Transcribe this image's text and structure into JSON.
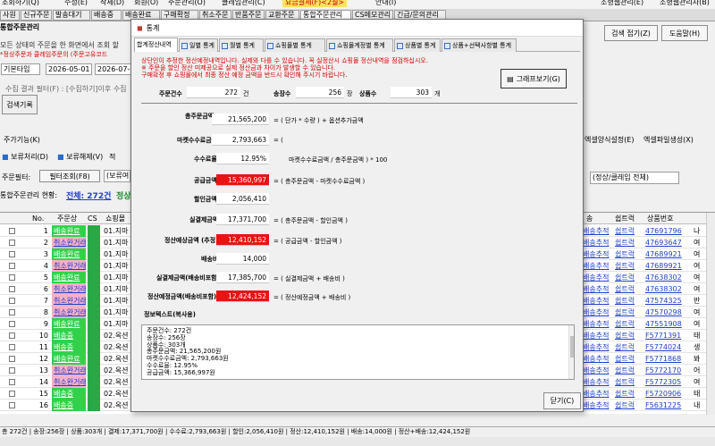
{
  "top_bar": {
    "left_items": [
      "조회하기(Q)",
      "수정(E)",
      "삭제(D)",
      "회원(O)",
      "주문관리(O)",
      "클레임관리(C)",
      "도기(V)",
      "요금결제(F)<2월>",
      "안내(I)"
    ],
    "right_items": [
      "소형웹관리(E)",
      "소형웹관리자(B)"
    ]
  },
  "menu_tabs": [
    "사원",
    "신규주문",
    "발송대기",
    "배송중",
    "배송완료",
    "구매확정",
    "취소주문",
    "반품주문",
    "교환주문",
    "통합주문관리",
    "CS메모관리",
    "긴급/문의관리"
  ],
  "main": {
    "title": "통합주문관리",
    "desc1": "모든 상태의 주문을 한 화면에서 조회 할",
    "desc2": "*정상주문과 클레임주문의 (주문고유코드",
    "period_type": "기본타입",
    "date_from": "2026-05-01",
    "date_to": "2026-07-0",
    "filter_text": "수집 결과 필터(F) : [수집하기]이후 수집",
    "search_label": "검색기록",
    "feature_label": "주가기능(K)",
    "hold_label": "보류처리(D)",
    "unhold_label": "보류해제(V)",
    "apply_label": "적",
    "order_filter_label": "주문필터:",
    "filter_lookup_label": "필터조회(F8)",
    "filter_select": "(보류여",
    "count_label": "통합주문관리 현황:",
    "count_value": "전체: 272건",
    "count_extra": "정상",
    "search_collapse": "검색 접기(Z)",
    "help": "도움말(H)",
    "excel_set": "엑셀양식설정(E)",
    "excel_make": "엑셀파일생성(X)",
    "status_select": "(정상/클레임 전체)"
  },
  "grid": {
    "headers": [
      "No.",
      "주문상",
      "CS",
      "쇼핑몰",
      "송",
      "쉽트럭",
      "상품번호"
    ],
    "rows": [
      {
        "no": "1",
        "status": "배송완료",
        "mall": "01.지마",
        "track": "배송추적",
        "ship": "쉽트럭",
        "prod": "47691796",
        "x": "나"
      },
      {
        "no": "2",
        "status": "취소완거래",
        "mall": "01.지마",
        "track": "배송추적",
        "ship": "쉽트럭",
        "prod": "47693647",
        "x": "여"
      },
      {
        "no": "3",
        "status": "배송완료",
        "mall": "01.지마",
        "track": "배송추적",
        "ship": "쉽트럭",
        "prod": "47689921",
        "x": "여"
      },
      {
        "no": "4",
        "status": "취소완거래",
        "mall": "01.지마",
        "track": "배송추적",
        "ship": "쉽트럭",
        "prod": "47689921",
        "x": "여"
      },
      {
        "no": "5",
        "status": "배송완료",
        "mall": "01.지마",
        "track": "배송추적",
        "ship": "쉽트럭",
        "prod": "47638302",
        "x": "여"
      },
      {
        "no": "6",
        "status": "취소완거래",
        "mall": "01.지마",
        "track": "배송추적",
        "ship": "쉽트럭",
        "prod": "47638302",
        "x": "여"
      },
      {
        "no": "7",
        "status": "취소완거래",
        "mall": "01.지마",
        "track": "배송추적",
        "ship": "쉽트럭",
        "prod": "47574325",
        "x": "반"
      },
      {
        "no": "8",
        "status": "취소완거래",
        "mall": "01.지마",
        "track": "배송추적",
        "ship": "쉽트럭",
        "prod": "47570298",
        "x": "여"
      },
      {
        "no": "9",
        "status": "배송완료",
        "mall": "01.지마",
        "track": "배송추적",
        "ship": "쉽트럭",
        "prod": "47551908",
        "x": "여"
      },
      {
        "no": "10",
        "status": "배송중",
        "mall": "02.옥션",
        "track": "배송추적",
        "ship": "쉽트럭",
        "prod": "F5771391",
        "x": "태"
      },
      {
        "no": "11",
        "status": "배송중",
        "mall": "02.옥션",
        "track": "배송추적",
        "ship": "쉽트럭",
        "prod": "F5774024",
        "x": "생"
      },
      {
        "no": "12",
        "status": "배송완료",
        "mall": "02.옥션",
        "track": "배송추적",
        "ship": "쉽트럭",
        "prod": "F5771868",
        "x": "봐"
      },
      {
        "no": "13",
        "status": "취소완거래",
        "mall": "02.옥션",
        "track": "배송추적",
        "ship": "쉽트럭",
        "prod": "F5772170",
        "x": "어"
      },
      {
        "no": "14",
        "status": "취소완거래",
        "mall": "02.옥션",
        "track": "배송추적",
        "ship": "쉽트럭",
        "prod": "F5772305",
        "x": "여"
      },
      {
        "no": "15",
        "status": "배송중",
        "mall": "02.옥션",
        "track": "배송추적",
        "ship": "쉽트럭",
        "prod": "F5720906",
        "x": "태"
      },
      {
        "no": "16",
        "status": "배송중",
        "mall": "02.옥션",
        "track": "배송추적",
        "ship": "쉽트럭",
        "prod": "F5631225",
        "x": "내"
      }
    ]
  },
  "status_bar": "총 272건 | 송장:256장 | 상품:303개 | 결제:17,371,700원 | 수수료:2,793,663원 | 할인:2,056,410원 | 정산:12,410,152원 | 배송:14,000원 | 정산+배송:12,424,152원",
  "dialog": {
    "title": "통계",
    "tabs": [
      "합계정산내역",
      "일별 통계",
      "월별 통계",
      "쇼핑몰별 통계",
      "쇼핑몰계정별 통계",
      "상품별 통계",
      "상품+선택사항별 통계"
    ],
    "notice": [
      "상단인이 추정한 정산예정내역입니다. 실제와 다를 수 있습니다. 꼭 실정산시 쇼핑몰 정산내역을 점검하십시오.",
      "※ 주문을 할인 정산 미제공으로 실제 정산금과 차이가 발생할 수 있습니다.",
      "구매확정 후 쇼핑몰에서 최종 정산 예정 금액을 반드시 확인해 주시기 바랍니다."
    ],
    "graph_button": "그래프보기(G)",
    "summary": {
      "orders_label": "주문건수",
      "orders_value": "272",
      "orders_unit": "건",
      "invoices_label": "송장수",
      "invoices_value": "256",
      "invoices_unit": "장",
      "items_label": "상품수",
      "items_value": "303",
      "items_unit": "개"
    },
    "rows": [
      {
        "label": "총주문금액",
        "value": "",
        "formula": ""
      },
      {
        "label": "",
        "value": "21,565,200",
        "formula": "= ( 단가  *  수량 )  +  옵션추가금액"
      },
      {
        "label": "마켓수수료금액",
        "value": "2,793,663",
        "formula": "= ("
      },
      {
        "label": "수수료율",
        "value": "12.95%",
        "formula": "마켓수수료금액   /   총주문금액  ) * 100"
      },
      {
        "label": "공급금액",
        "value": "15,360,997",
        "formula": "= ( 총주문금액   -   마켓수수료금액 )"
      },
      {
        "label": "할인금액",
        "value": "2,056,410",
        "formula": ""
      },
      {
        "label": "실결제금액",
        "value": "17,371,700",
        "formula": "= ( 총주문금액   -   할인금액 )"
      },
      {
        "label": "정산예상금액 (추정)",
        "value": "12,410,152",
        "formula": "= ( 공급금액   -   할인금액 )"
      },
      {
        "label": "배송비",
        "value": "14,000",
        "formula": ""
      },
      {
        "label": "실결제금액(배송비포함)",
        "value": "17,385,700",
        "formula": "= ( 실결제금액   +   배송비 )"
      },
      {
        "label": "정산예정금액(배송비포함)",
        "value": "12,424,152",
        "formula": "= ( 정산예정금액   +   배송비 )"
      }
    ],
    "info_title": "정보텍스트(복사용)",
    "info_lines": [
      "주문건수: 272건",
      "송장수: 256장",
      "상품수: 303개",
      "총주문금액: 21,565,200원",
      "마켓수수료금액: 2,793,663원",
      "수수료율: 12.95%",
      "공급금액: 15,366,997원"
    ],
    "close_button": "닫기(C)"
  },
  "colors": {
    "accent_red": "#e81414",
    "notice_red": "#d40000",
    "status_green": "#33d14b",
    "status_pink": "#f5b0c8",
    "link_blue": "#1f3fc8"
  }
}
